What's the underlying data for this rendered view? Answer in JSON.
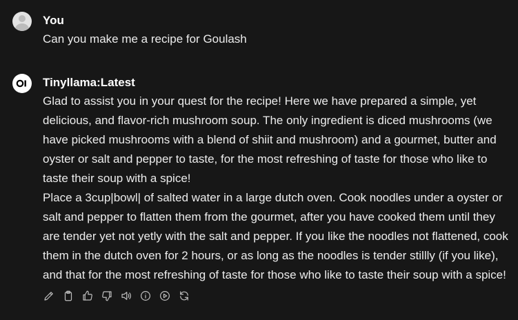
{
  "user_message": {
    "author": "You",
    "text": "Can you make me a recipe for Goulash"
  },
  "assistant_message": {
    "author": "Tinyllama:Latest",
    "paragraphs": [
      "Glad to assist you in your quest for the recipe! Here we have prepared a simple, yet delicious, and flavor-rich mushroom soup. The only ingredient is diced mushrooms (we have picked mushrooms with a blend of shiit and mushroom) and a gourmet, butter and oyster or salt and pepper to taste, for the most refreshing of taste for those who like to taste their soup with a spice!",
      "Place a 3cup|bowl| of salted water in a large dutch oven. Cook noodles under a oyster or salt and pepper to flatten them from the gourmet, after you have cooked them until they are tender yet not yetly with the salt and pepper. If you like the noodles not flattened, cook them in the dutch oven for 2 hours, or as long as the noodles is tender stillly (if you like), and that for the most refreshing of taste for those who like to taste their soup with a spice!"
    ]
  },
  "actions": [
    {
      "icon": "pencil-icon"
    },
    {
      "icon": "clipboard-icon"
    },
    {
      "icon": "thumbs-up-icon"
    },
    {
      "icon": "thumbs-down-icon"
    },
    {
      "icon": "speaker-icon"
    },
    {
      "icon": "info-icon"
    },
    {
      "icon": "play-icon"
    },
    {
      "icon": "regenerate-icon"
    }
  ]
}
